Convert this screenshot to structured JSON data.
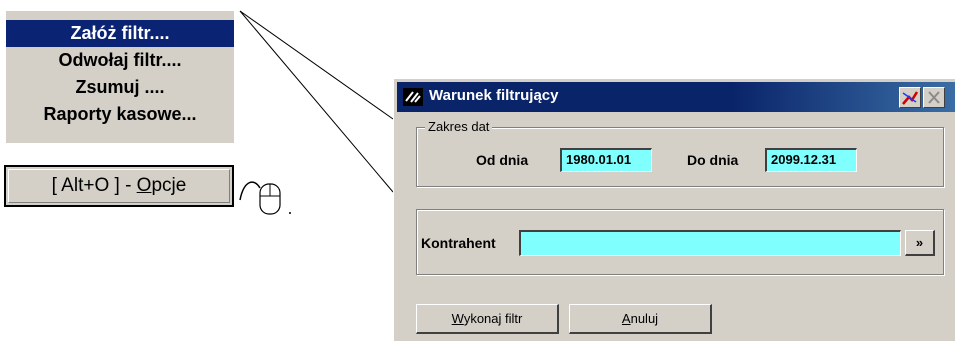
{
  "context_menu": {
    "items": [
      {
        "label": "Załóż filtr....",
        "selected": true
      },
      {
        "label": "Odwołaj filtr....",
        "selected": false
      },
      {
        "label": "Zsumuj ....",
        "selected": false
      },
      {
        "label": "Raporty kasowe...",
        "selected": false
      }
    ]
  },
  "options_button": {
    "label_prefix": "[ Alt+O ] - ",
    "label_accel": "O",
    "label_rest": "pcje"
  },
  "dialog": {
    "title": "Warunek filtrujący",
    "date_group": {
      "title": "Zakres dat",
      "from_label": "Od dnia",
      "from_value": "1980.01.01",
      "to_label": "Do dnia",
      "to_value": "2099.12.31"
    },
    "contractor": {
      "label": "Kontrahent",
      "value": "",
      "browse_label": "»"
    },
    "buttons": {
      "apply_accel": "W",
      "apply_rest": "ykonaj filtr",
      "cancel_accel": "A",
      "cancel_rest": "nuluj"
    }
  },
  "colors": {
    "selection": "#0a2473",
    "field_bg": "#80ffff",
    "face": "#d4d0c8",
    "titlebar": "#0a246a"
  },
  "icons": [
    "app-icon",
    "help-icon",
    "close-icon",
    "mouse-icon"
  ]
}
